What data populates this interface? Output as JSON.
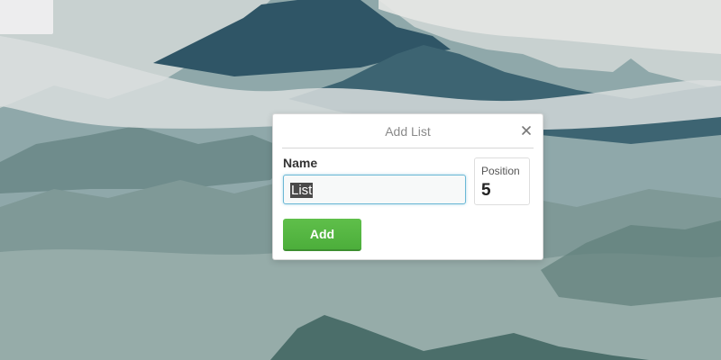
{
  "dialog": {
    "title": "Add List",
    "close_icon": "close-icon",
    "name_label": "Name",
    "name_value": "List",
    "position_label": "Position",
    "position_value": "5",
    "add_label": "Add"
  },
  "colors": {
    "add_button": "#5aaf42",
    "input_focus_border": "#6bb8d6",
    "selection": "#4a4a4a"
  }
}
